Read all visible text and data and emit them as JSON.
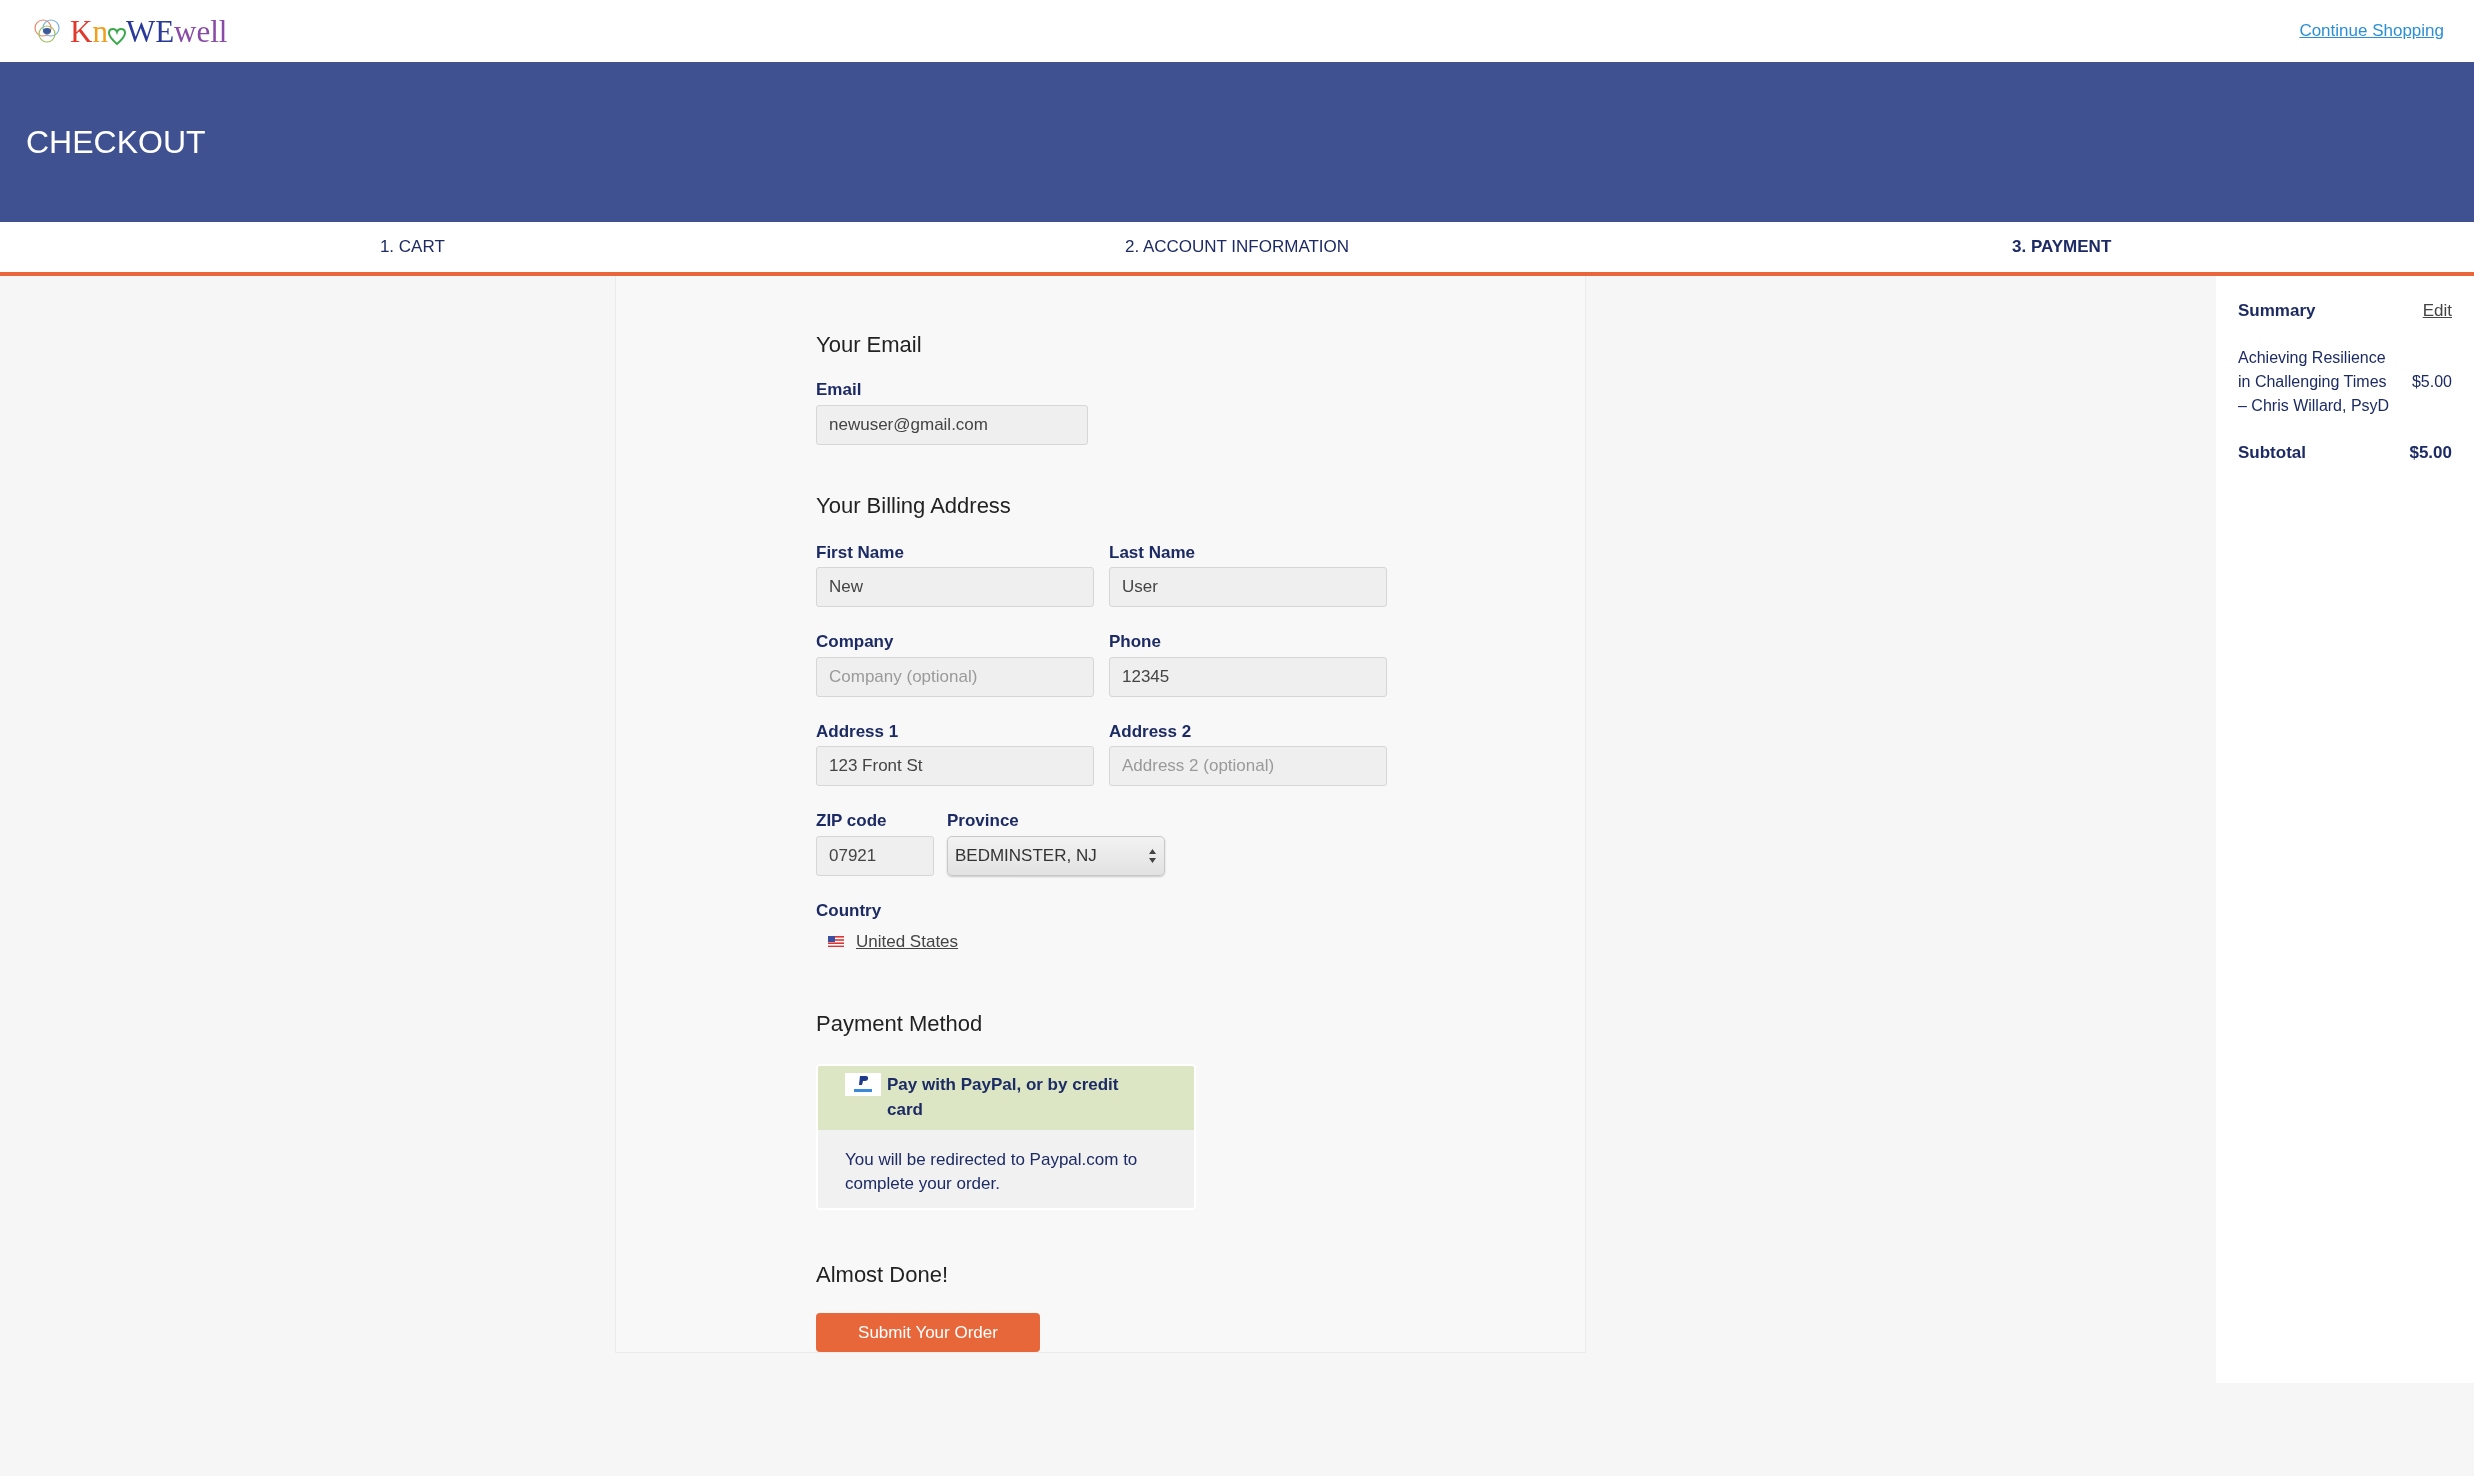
{
  "logo": {
    "parts": [
      {
        "text": "K",
        "color": "#e0392b"
      },
      {
        "text": "n",
        "color": "#f0a020"
      },
      {
        "text": "WE",
        "color": "#2a3a9a"
      },
      {
        "text": "well",
        "color": "#8a4aa8"
      }
    ]
  },
  "header_link": "Continue Shopping",
  "page_title": "CHECKOUT",
  "steps": [
    {
      "label": "1. CART",
      "selected": false
    },
    {
      "label": "2. ACCOUNT INFORMATION",
      "selected": false
    },
    {
      "label": "3. PAYMENT",
      "selected": true
    }
  ],
  "email_section": {
    "heading": "Your Email",
    "label": "Email",
    "value": "newuser@gmail.com"
  },
  "billing": {
    "heading": "Your Billing Address",
    "rows": [
      [
        {
          "kind": "text",
          "label": "First Name",
          "value": "New"
        },
        {
          "kind": "text",
          "label": "Last Name",
          "value": "User"
        }
      ],
      [
        {
          "kind": "text",
          "label": "Company",
          "placeholder": "Company (optional)"
        },
        {
          "kind": "text",
          "label": "Phone",
          "value": "12345"
        }
      ],
      [
        {
          "kind": "text",
          "label": "Address 1",
          "value": "123 Front St"
        },
        {
          "kind": "text",
          "label": "Address 2",
          "placeholder": "Address 2 (optional)"
        }
      ],
      [
        {
          "kind": "short",
          "label": "ZIP code",
          "value": "07921"
        },
        {
          "kind": "select",
          "label": "Province",
          "value": "BEDMINSTER, NJ"
        }
      ],
      [
        {
          "kind": "country",
          "label": "Country",
          "value": "United States"
        }
      ]
    ]
  },
  "payment": {
    "heading": "Payment Method",
    "option": "Pay with PayPal, or by credit card",
    "note": "You will be redirected to Paypal.com to complete your order."
  },
  "finish": {
    "heading": "Almost Done!",
    "button": "Submit Your Order"
  },
  "summary": {
    "title": "Summary",
    "edit": "Edit",
    "item": "Achieving Resilience in Challenging Times",
    "item_price": "$5.00",
    "item_author": "– Chris Willard, PsyD",
    "subtotal_label": "Subtotal",
    "subtotal": "$5.00"
  }
}
